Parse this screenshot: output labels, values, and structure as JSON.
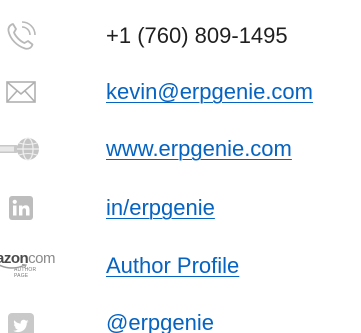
{
  "colors": {
    "link": "#0563c1",
    "text": "#1f1f1f",
    "icon_gray": "#bdbdbd"
  },
  "contacts": [
    {
      "icon": "phone-icon",
      "text": "+1 (760) 809-1495",
      "is_link": false
    },
    {
      "icon": "envelope-icon",
      "text": "kevin@erpgenie.com",
      "is_link": true
    },
    {
      "icon": "globe-key-icon",
      "text": "www.erpgenie.com",
      "is_link": true
    },
    {
      "icon": "linkedin-icon",
      "text": "in/erpgenie",
      "is_link": true
    },
    {
      "icon": "amazon-author-icon",
      "text": "Author Profile",
      "is_link": true
    },
    {
      "icon": "twitter-icon",
      "text": "@erpgenie",
      "is_link": true
    }
  ],
  "amazon_logo": {
    "brand": "azon",
    "suffix": "com",
    "subtitle": "AUTHOR PAGE"
  }
}
